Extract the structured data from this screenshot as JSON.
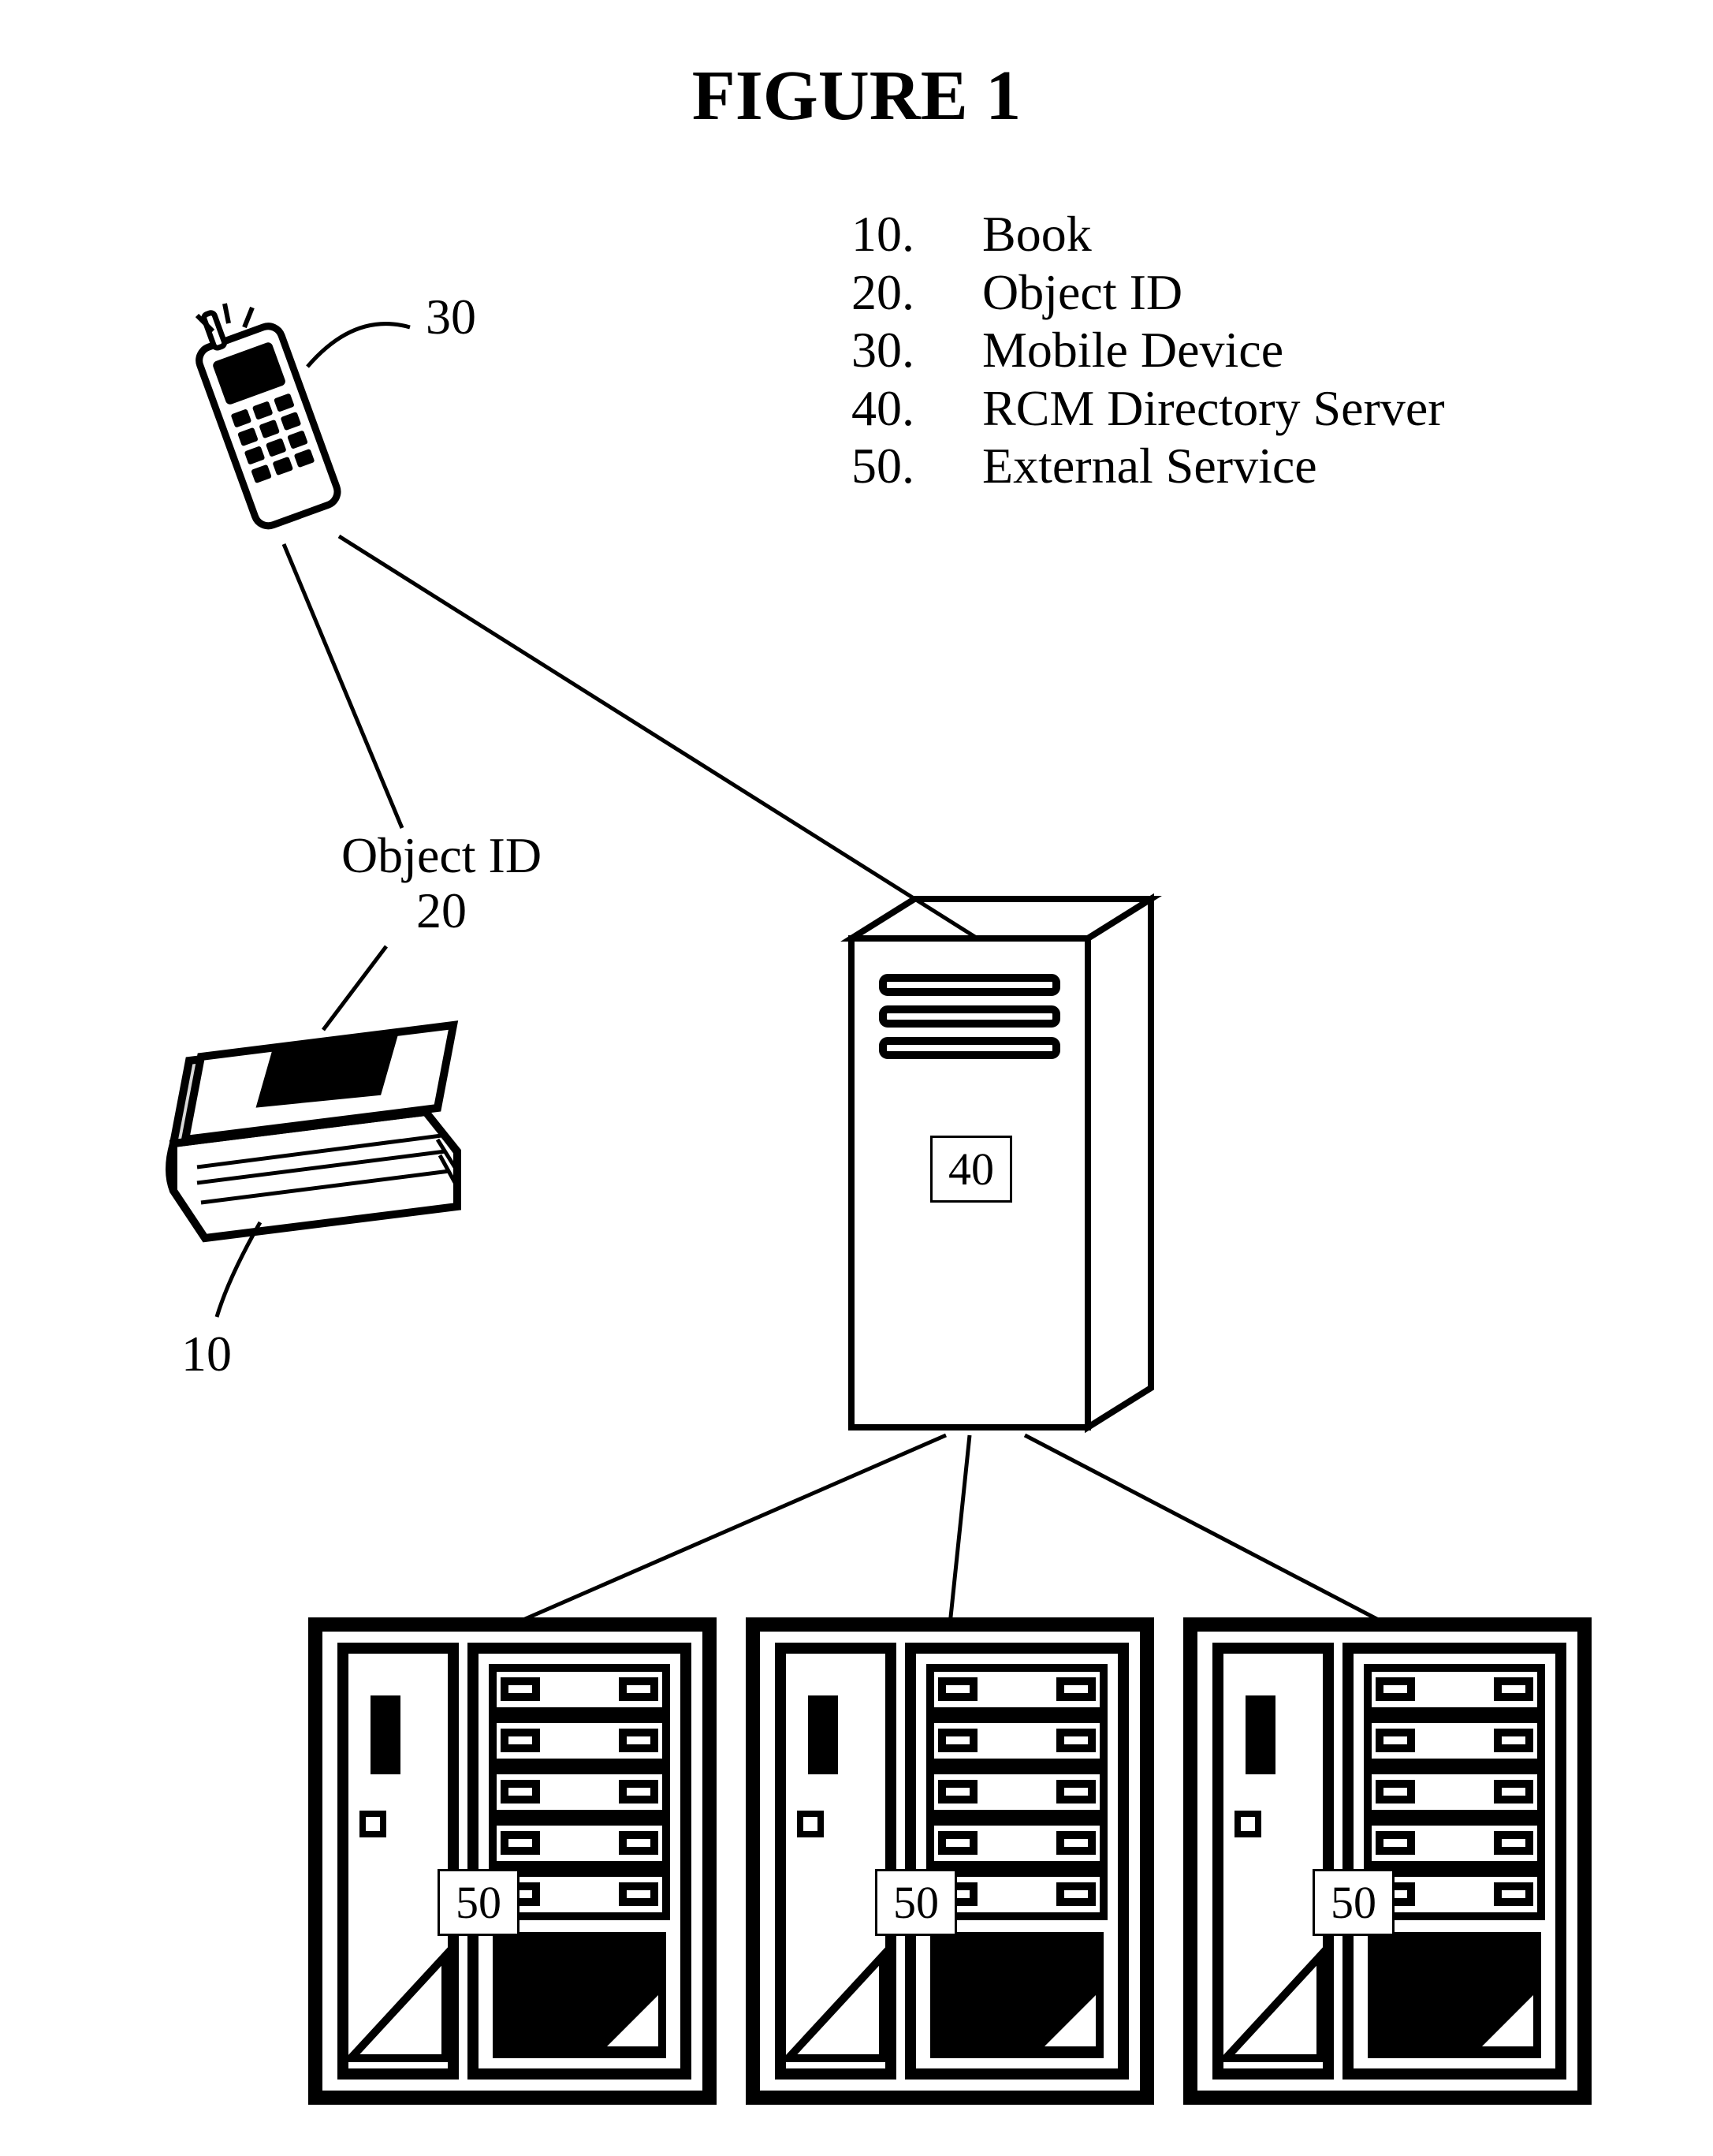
{
  "figure_title": "FIGURE 1",
  "legend": {
    "items": [
      {
        "num": "10.",
        "text": "Book"
      },
      {
        "num": "20.",
        "text": "Object ID"
      },
      {
        "num": "30.",
        "text": "Mobile Device"
      },
      {
        "num": "40.",
        "text": "RCM Directory Server"
      },
      {
        "num": "50.",
        "text": "External Service"
      }
    ]
  },
  "items": {
    "book_ref": "10",
    "object_id_label_line1": "Object ID",
    "object_id_label_line2": "20",
    "mobile_ref": "30",
    "server_ref": "40",
    "ext1_ref": "50",
    "ext2_ref": "50",
    "ext3_ref": "50"
  }
}
